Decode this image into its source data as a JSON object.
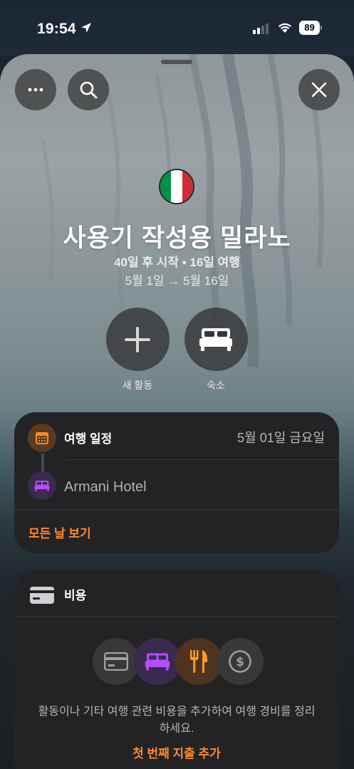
{
  "status": {
    "time": "19:54",
    "battery": "89"
  },
  "trip": {
    "title": "사용기 작성용 밀라노",
    "subtitle": "40일 후 시작 • 16일 여행",
    "dates": "5월 1일 → 5월 16일",
    "flag_colors": [
      "#009246",
      "#ffffff",
      "#ce2b37"
    ]
  },
  "actions": {
    "new_activity": "새 활동",
    "lodging": "숙소"
  },
  "itinerary": {
    "title": "여행 일정",
    "date": "5월 01일 금요일",
    "hotel": "Armani Hotel",
    "see_all": "모든 날 보기"
  },
  "expenses": {
    "title": "비용",
    "description": "활동이나 기타 여행 관련 비용을 추가하여 여행 경비를 정리하세요.",
    "add": "첫 번째 지출 추가"
  },
  "colors": {
    "accent": "#ff8a2a",
    "purple": "#b44cff",
    "orange": "#ff9a2a",
    "card": "#232326"
  },
  "icons": [
    "location-arrow-icon",
    "more-icon",
    "search-icon",
    "close-icon",
    "plus-icon",
    "bed-icon",
    "calendar-icon",
    "credit-card-icon",
    "fork-knife-icon",
    "dollar-icon"
  ]
}
